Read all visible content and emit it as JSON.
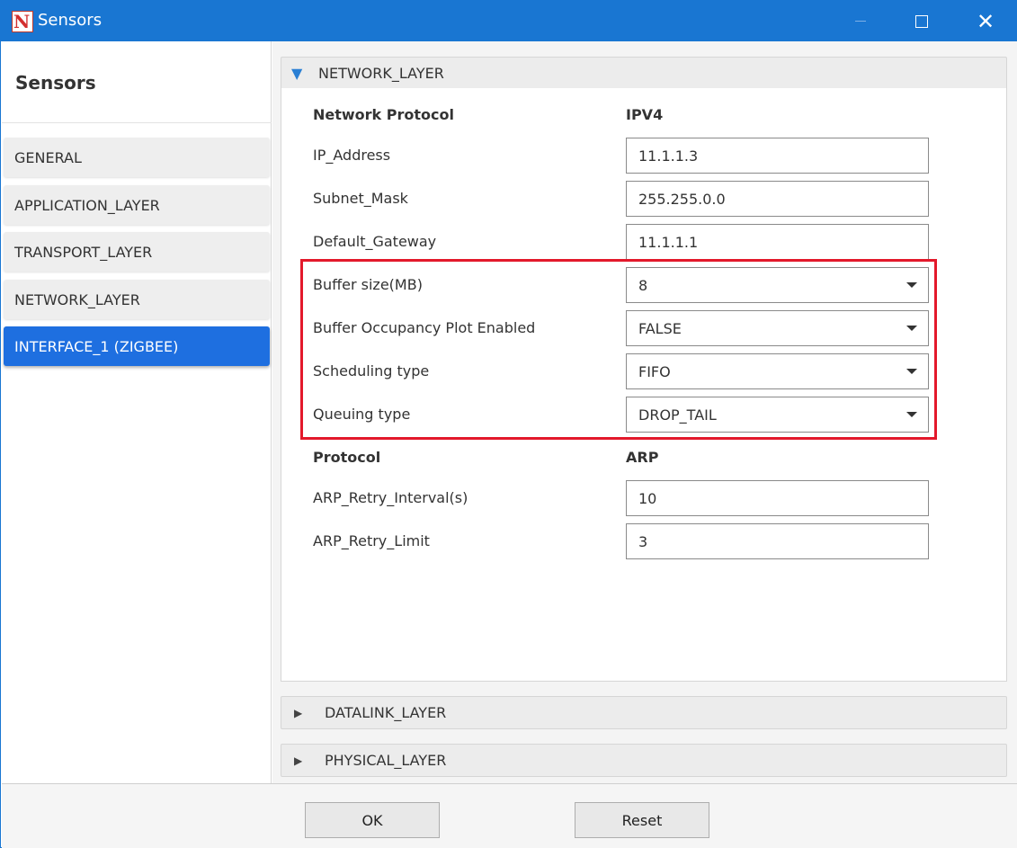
{
  "window": {
    "title": "Sensors",
    "accent": "#1976d2",
    "close_glyph": "✕"
  },
  "sidebar": {
    "title": "Sensors",
    "items": [
      {
        "label": "GENERAL",
        "active": false
      },
      {
        "label": "APPLICATION_LAYER",
        "active": false
      },
      {
        "label": "TRANSPORT_LAYER",
        "active": false
      },
      {
        "label": "NETWORK_LAYER",
        "active": false
      },
      {
        "label": "INTERFACE_1 (ZIGBEE)",
        "active": true
      }
    ],
    "active_color": "#1e6fe0"
  },
  "network_layer": {
    "header": "NETWORK_LAYER",
    "expanded": true,
    "network_protocol_label": "Network Protocol",
    "network_protocol_value": "IPV4",
    "ip_address_label": "IP_Address",
    "ip_address_value": "11.1.1.3",
    "subnet_mask_label": "Subnet_Mask",
    "subnet_mask_value": "255.255.0.0",
    "default_gateway_label": "Default_Gateway",
    "default_gateway_value": "11.1.1.1",
    "buffer_size_label": "Buffer size(MB)",
    "buffer_size_value": "8",
    "buffer_plot_label": "Buffer Occupancy Plot Enabled",
    "buffer_plot_value": "FALSE",
    "scheduling_label": "Scheduling type",
    "scheduling_value": "FIFO",
    "queuing_label": "Queuing type",
    "queuing_value": "DROP_TAIL",
    "protocol_label": "Protocol",
    "protocol_value": "ARP",
    "arp_interval_label": "ARP_Retry_Interval(s)",
    "arp_interval_value": "10",
    "arp_limit_label": "ARP_Retry_Limit",
    "arp_limit_value": "3",
    "highlight_color": "#e3192b"
  },
  "collapsed_sections": {
    "datalink": "DATALINK_LAYER",
    "physical": "PHYSICAL_LAYER"
  },
  "footer": {
    "ok_label": "OK",
    "reset_label": "Reset"
  }
}
